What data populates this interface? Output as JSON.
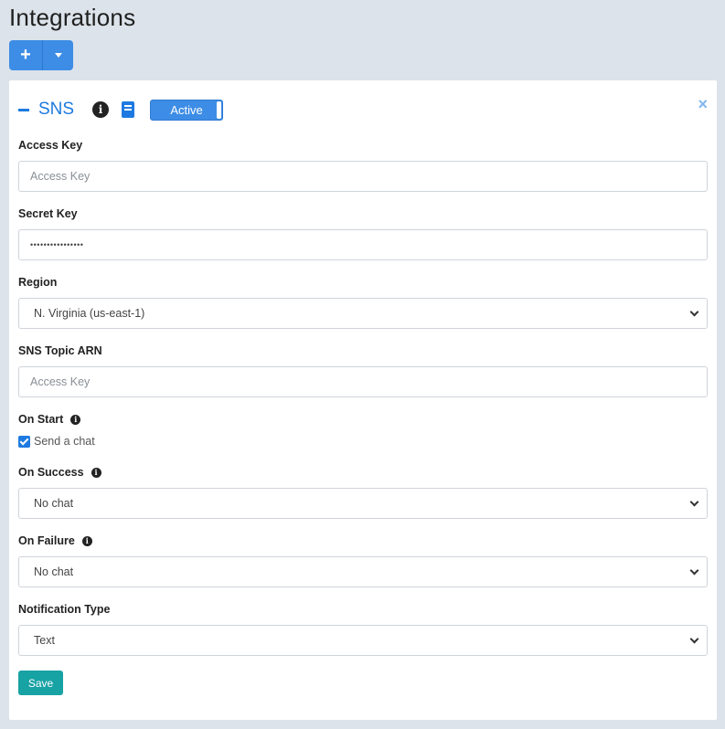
{
  "page": {
    "title": "Integrations"
  },
  "toolbar": {
    "add_label": "+"
  },
  "integration": {
    "name": "SNS",
    "status_label": "Active",
    "close_glyph": "×",
    "info_glyph": "i"
  },
  "form": {
    "access_key": {
      "label": "Access Key",
      "placeholder": "Access Key",
      "value": ""
    },
    "secret_key": {
      "label": "Secret Key",
      "value": "••••••••••••••••"
    },
    "region": {
      "label": "Region",
      "value": "N. Virginia (us-east-1)"
    },
    "topic_arn": {
      "label": "SNS Topic ARN",
      "placeholder": "Access Key",
      "value": ""
    },
    "on_start": {
      "label": "On Start",
      "checkbox_label": "Send a chat",
      "checked": true
    },
    "on_success": {
      "label": "On Success",
      "value": "No chat"
    },
    "on_failure": {
      "label": "On Failure",
      "value": "No chat"
    },
    "notification_type": {
      "label": "Notification Type",
      "value": "Text"
    },
    "save_label": "Save"
  },
  "colors": {
    "accent": "#3d8de6",
    "save": "#17a2a4",
    "background": "#dce3ea"
  }
}
